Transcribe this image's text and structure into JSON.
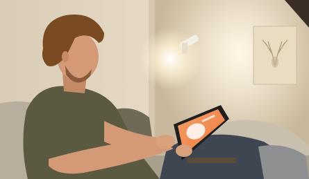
{
  "scene": {
    "kind": "photograph",
    "subject": "man-on-couch-using-tablet",
    "palette": {
      "wall": "#e2d5c0",
      "wall_shadow": "#b9a98f",
      "couch": "#bdb3a3",
      "tshirt": "#5c5a42",
      "skin": "#d49a78",
      "hair": "#7a4a22",
      "jeans": "#3f4a55",
      "tablet_screen": "#f08850",
      "lamp_glow": "#fff6e0",
      "art": "#e7dcc3"
    },
    "icons": [
      "wall-lamp-icon",
      "deer-art-icon",
      "tablet-icon"
    ]
  }
}
